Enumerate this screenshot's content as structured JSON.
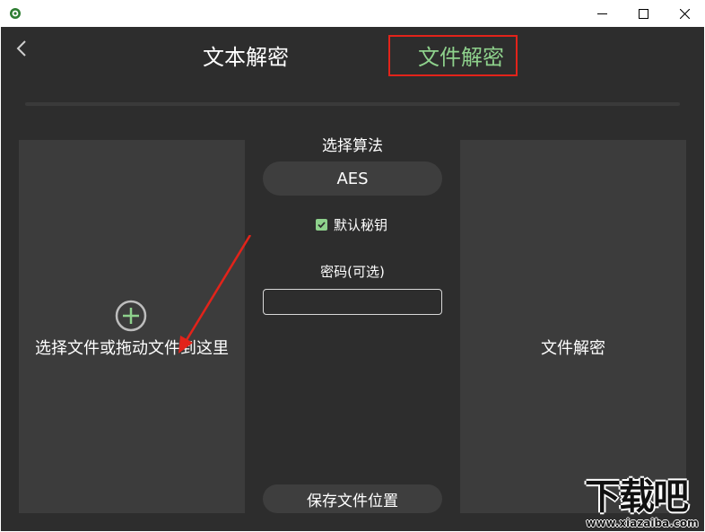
{
  "header": {
    "tabs": [
      {
        "label": "文本解密",
        "active": false
      },
      {
        "label": "文件解密",
        "active": true
      }
    ]
  },
  "left_panel": {
    "drop_text": "选择文件或拖动文件到这里",
    "icon": "plus-circle-icon"
  },
  "center": {
    "algorithm_label": "选择算法",
    "algorithm_value": "AES",
    "default_key_label": "默认秘钥",
    "default_key_checked": true,
    "password_label": "密码(可选)",
    "password_value": "",
    "save_location_label": "保存文件位置"
  },
  "right_panel": {
    "action_label": "文件解密"
  },
  "colors": {
    "background": "#2d2d2d",
    "panel": "#3c3c3c",
    "accent_green": "#8ed18c",
    "highlight_red": "#e2231a"
  },
  "watermark": {
    "main": "下载吧",
    "sub": "www.xiazaiba.com"
  }
}
